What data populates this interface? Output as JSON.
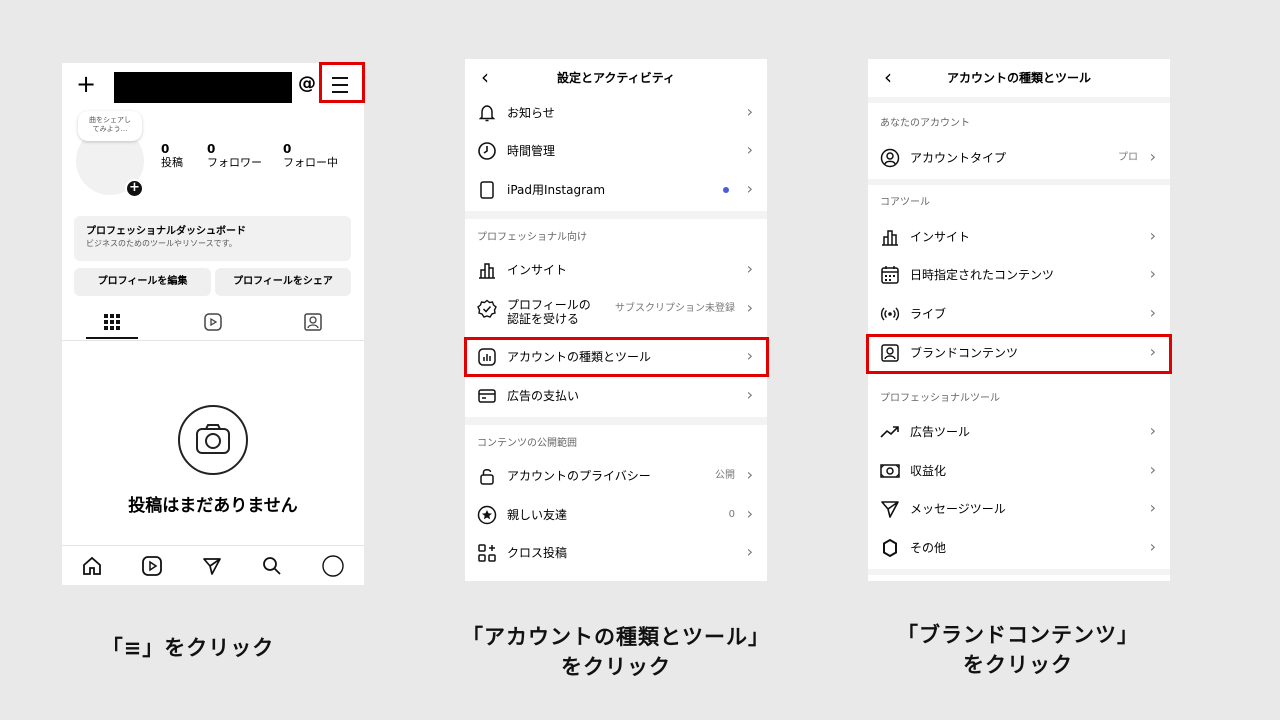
{
  "panel1": {
    "bubble_text": "曲をシェアし\nてみよう...",
    "stats": [
      {
        "count": "0",
        "label": "投稿"
      },
      {
        "count": "0",
        "label": "フォロワー"
      },
      {
        "count": "0",
        "label": "フォロー中"
      }
    ],
    "dashboard": {
      "title": "プロフェッショナルダッシュボード",
      "subtitle": "ビジネスのためのツールやリソースです。"
    },
    "buttons": {
      "edit": "プロフィールを編集",
      "share": "プロフィールをシェア"
    },
    "empty_text": "投稿はまだありません",
    "caption": "「≡」をクリック"
  },
  "panel2": {
    "title": "設定とアクティビティ",
    "rows_top": [
      {
        "label": "お知らせ",
        "icon": "bell-icon"
      },
      {
        "label": "時間管理",
        "icon": "clock-icon"
      },
      {
        "label": "iPad用Instagram",
        "icon": "tablet-icon"
      }
    ],
    "section_pro": "プロフェッショナル向け",
    "rows_pro": [
      {
        "label": "インサイト",
        "icon": "insights-icon"
      },
      {
        "label": "プロフィールの\n認証を受ける",
        "value": "サブスクリプション未登録",
        "icon": "verified-icon"
      },
      {
        "label": "アカウントの種類とツール",
        "icon": "account-tools-icon"
      },
      {
        "label": "広告の支払い",
        "icon": "card-icon"
      }
    ],
    "section_content": "コンテンツの公開範囲",
    "rows_content": [
      {
        "label": "アカウントのプライバシー",
        "value": "公開",
        "icon": "lock-icon"
      },
      {
        "label": "親しい友達",
        "value": "0",
        "icon": "star-icon"
      },
      {
        "label": "クロス投稿",
        "icon": "grid-plus-icon"
      }
    ],
    "caption_line1": "「アカウントの種類とツール」",
    "caption_line2": "をクリック"
  },
  "panel3": {
    "title": "アカウントの種類とツール",
    "section_account": "あなたのアカウント",
    "account_row": {
      "label": "アカウントタイプ",
      "value": "プロ"
    },
    "section_core": "コアツール",
    "core_rows": [
      {
        "label": "インサイト",
        "icon": "insights-icon"
      },
      {
        "label": "日時指定されたコンテンツ",
        "icon": "calendar-icon"
      },
      {
        "label": "ライブ",
        "icon": "live-icon"
      },
      {
        "label": "ブランドコンテンツ",
        "icon": "brand-content-icon"
      }
    ],
    "section_pro": "プロフェッショナルツール",
    "pro_rows": [
      {
        "label": "広告ツール",
        "icon": "trend-icon"
      },
      {
        "label": "収益化",
        "icon": "money-icon"
      },
      {
        "label": "メッセージツール",
        "icon": "send-icon"
      },
      {
        "label": "その他",
        "icon": "more-icon"
      }
    ],
    "caption_line1": "「ブランドコンテンツ」",
    "caption_line2": "をクリック"
  },
  "colors": {
    "highlight": "#e00000",
    "background": "#e9e9e9",
    "dot": "#4a5be0"
  }
}
